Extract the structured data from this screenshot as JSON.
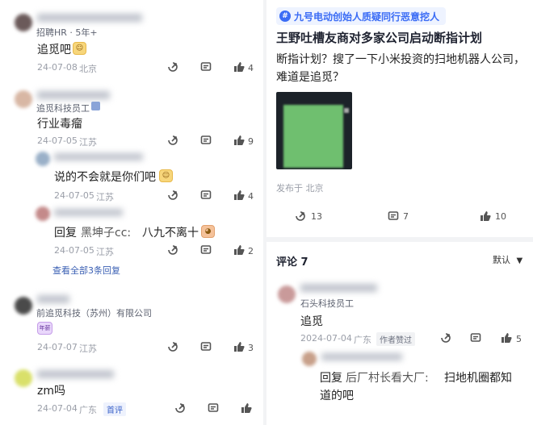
{
  "left": {
    "c1": {
      "role": "招聘HR · 5年+",
      "text": "追觅吧",
      "date": "24-07-08",
      "loc": "北京",
      "likes": "4"
    },
    "c2": {
      "company": "追觅科技员工",
      "text": "行业毒瘤",
      "date": "24-07-05",
      "loc": "江苏",
      "likes": "9",
      "reply1": {
        "text": "说的不会就是你们吧",
        "date": "24-07-05",
        "loc": "江苏",
        "likes": "4"
      },
      "reply2": {
        "prefix": "回复",
        "target": "黑坤子cc:",
        "text": "八九不离十",
        "date": "24-07-05",
        "loc": "江苏",
        "likes": "2"
      },
      "view_all": "查看全部3条回复"
    },
    "c3": {
      "company": "前追觅科技（苏州）有限公司",
      "badge": "年薪",
      "date": "24-07-07",
      "loc": "江苏",
      "likes": "3"
    },
    "c4": {
      "text": "zm吗",
      "date": "24-07-04",
      "loc": "广东",
      "tag": "首评"
    }
  },
  "right": {
    "topic": "九号电动创始人质疑同行恶意挖人",
    "topic_icon": "#",
    "title": "王野吐槽友商对多家公司启动断指计划",
    "body": "断指计划？搜了一下小米投资的扫地机器人公司，难道是追觅？",
    "posted_from": "发布于 北京",
    "shares": "13",
    "comments": "7",
    "likes": "10",
    "comments_header": "评论 7",
    "sort_label": "默认",
    "rc1": {
      "company": "石头科技员工",
      "text": "追觅",
      "date": "2024-07-04",
      "loc": "广东",
      "author_tag": "作者赞过",
      "likes": "5"
    },
    "rc2": {
      "prefix": "回复",
      "target": "后厂村长看大厂:",
      "text_line1": "扫地机圈都知",
      "text_line2": "道的吧"
    }
  },
  "colors": {
    "accent": "#3b6cf5",
    "link": "#3a5fb3",
    "meta": "#9a9ea8",
    "separator": "#f2f3f5"
  }
}
